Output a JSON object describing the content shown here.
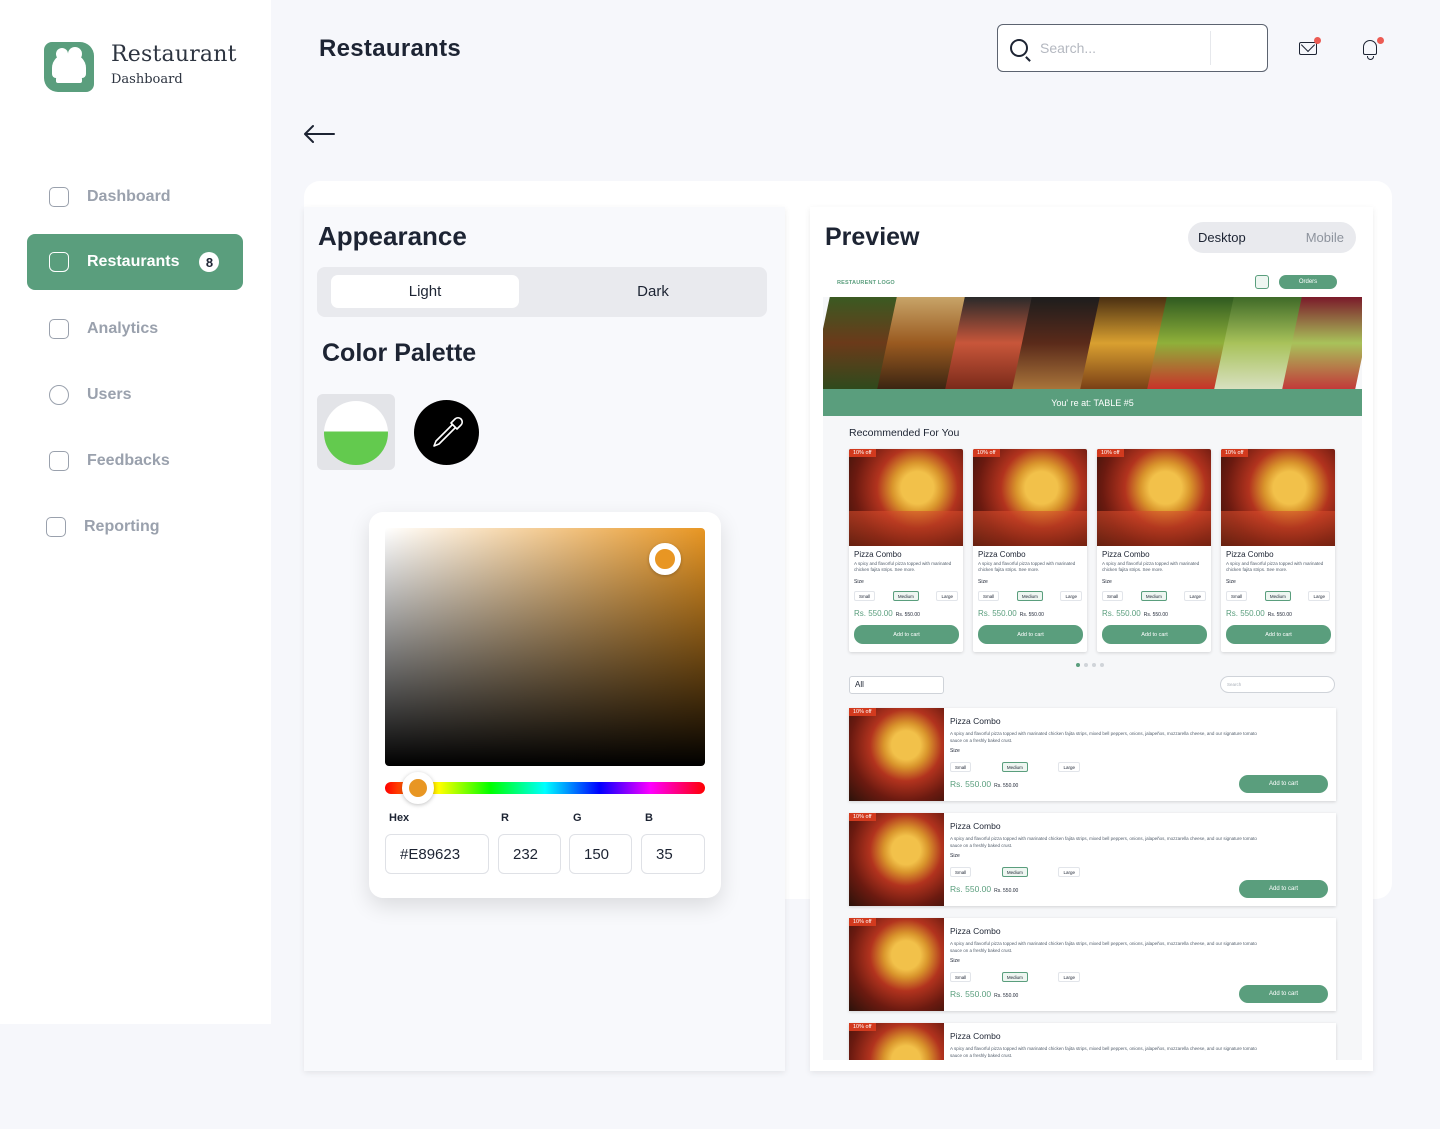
{
  "brand": {
    "title": "Restaurant",
    "subtitle": "Dashboard"
  },
  "nav": [
    {
      "label": "Dashboard",
      "icon": "chart-icon"
    },
    {
      "label": "Restaurants",
      "icon": "bag-icon",
      "badge": "8",
      "active": true
    },
    {
      "label": "Analytics",
      "icon": "bar-chart-icon"
    },
    {
      "label": "Users",
      "icon": "users-icon"
    },
    {
      "label": "Feedbacks",
      "icon": "document-icon"
    },
    {
      "label": "Reporting",
      "icon": "report-icon"
    }
  ],
  "header": {
    "title": "Restaurants",
    "search_placeholder": "Search..."
  },
  "appearance": {
    "title": "Appearance",
    "modes": [
      "Light",
      "Dark"
    ],
    "selected_mode": "Light",
    "palette_title": "Color Palette",
    "color": {
      "hex_label": "Hex",
      "r_label": "R",
      "g_label": "G",
      "b_label": "B",
      "hex": "#E89623",
      "r": "232",
      "g": "150",
      "b": "35"
    }
  },
  "preview": {
    "title": "Preview",
    "views": [
      "Desktop",
      "Mobile"
    ],
    "selected_view": "Desktop",
    "site": {
      "logo": "RESTAURENT LOGO",
      "orders_label": "Orders",
      "table_text": "You' re at: TABLE  #5",
      "recommended_title": "Recommended For You",
      "filter_value": "All",
      "search_placeholder": "Search",
      "item": {
        "discount": "10% off",
        "name": "Pizza Combo",
        "desc_short": "A spicy and flavorful pizza topped with marinated chicken fajita strips. See more.",
        "desc_long": "A spicy and flavorful pizza topped with marinated chicken fajita strips, mixed bell peppers, onions, jalapeños, mozzarella cheese, and our signature tomato sauce on a freshly baked crust.",
        "size_label": "Size",
        "sizes": [
          "Small",
          "Medium",
          "Large"
        ],
        "price": "Rs. 550.00",
        "old_price": "Rs. 550.00",
        "add_label": "Add to cart"
      }
    }
  },
  "colors": {
    "accent": "#5A9E7D",
    "picked": "#E89623",
    "discount": "#D23A1E"
  }
}
